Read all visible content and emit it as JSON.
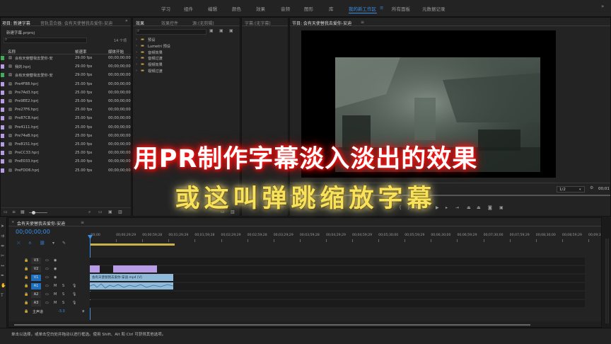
{
  "workspaces": [
    {
      "label": "学习"
    },
    {
      "label": "组件"
    },
    {
      "label": "编辑"
    },
    {
      "label": "颜色"
    },
    {
      "label": "效果"
    },
    {
      "label": "音频"
    },
    {
      "label": "图形"
    },
    {
      "label": "库"
    },
    {
      "label": "我的新工作区",
      "active": true
    },
    {
      "label": "≡"
    },
    {
      "label": "所有面板"
    },
    {
      "label": "元数据记录"
    }
  ],
  "project_panel": {
    "tabs": [
      "项目: 新建字幕",
      "音轨混合器: 会有天使替我去爱你-安迪"
    ],
    "project_file": "新建字幕.prproj",
    "item_count": "14 个项",
    "columns": {
      "name": "名称",
      "fps": "帧速率",
      "start": "媒体开始"
    },
    "items": [
      {
        "name": "会有天使替我去爱你-安",
        "fps": "29.00 fps",
        "start": "00;00;00;00",
        "color": "#3fae5a"
      },
      {
        "name": "我的.hprj",
        "fps": "29.00 fps",
        "start": "00;00;00;00",
        "color": "#b89ce6"
      },
      {
        "name": "会有天使替我去爱你-安",
        "fps": "29.00 fps",
        "start": "00;00;00;00",
        "color": "#3fae5a"
      },
      {
        "name": "Pre4F88.hprj",
        "fps": "25.00 fps",
        "start": "00;00;00;00",
        "color": "#b89ce6"
      },
      {
        "name": "Pre7Ad3.hprj",
        "fps": "25.00 fps",
        "start": "00;00;00;00",
        "color": "#b89ce6"
      },
      {
        "name": "Pre9EE2.hprj",
        "fps": "25.00 fps",
        "start": "00;00;00;00",
        "color": "#b89ce6"
      },
      {
        "name": "Pre27F6.hprj",
        "fps": "25.00 fps",
        "start": "00;00;00;00",
        "color": "#b89ce6"
      },
      {
        "name": "Pre87C8.hprj",
        "fps": "25.00 fps",
        "start": "00;00;00;00",
        "color": "#b89ce6"
      },
      {
        "name": "Pre4111.hprj",
        "fps": "25.00 fps",
        "start": "00;00;00;00",
        "color": "#b89ce6"
      },
      {
        "name": "Pre74eB.hprj",
        "fps": "25.00 fps",
        "start": "00;00;00;00",
        "color": "#b89ce6"
      },
      {
        "name": "Pre8151.hprj",
        "fps": "25.00 fps",
        "start": "00;00;00;00",
        "color": "#b89ce6"
      },
      {
        "name": "PreCC33.hprj",
        "fps": "25.00 fps",
        "start": "00;00;00;00",
        "color": "#b89ce6"
      },
      {
        "name": "PreE033.hprj",
        "fps": "25.00 fps",
        "start": "00;00;00;00",
        "color": "#b89ce6"
      },
      {
        "name": "PreFDD6.hprj",
        "fps": "25.00 fps",
        "start": "00;00;00;00",
        "color": "#b89ce6"
      }
    ]
  },
  "effects_panel": {
    "tabs": [
      "效果",
      "效果控件",
      "源:(无剪辑)"
    ],
    "tree": [
      {
        "label": "预设"
      },
      {
        "label": "Lumetri 预设"
      },
      {
        "label": "音频效果"
      },
      {
        "label": "音频过渡"
      },
      {
        "label": "视频效果"
      },
      {
        "label": "视频过渡"
      }
    ]
  },
  "source_panel": {
    "tab": "字幕:(无字幕)"
  },
  "program_panel": {
    "tab": "节目: 会有天使替我去爱你-安迪",
    "resolution": "1/2",
    "timecode": "00;01"
  },
  "timeline": {
    "tab": "会有天使替我去爱你-安迪",
    "timecode": "00;00;00;00",
    "ruler": [
      ":00;00",
      "00;00;29;29",
      "00;00;59;28",
      "00;01;29;29",
      "00;01;59;28",
      "00;02;29;29",
      "00;02;59;28",
      "00;03;29;29",
      "00;03;59;28",
      "00;04;29;29",
      "00;04;59;29",
      "00;05;30;00",
      "00;05;59;29",
      "00;06;30;00",
      "00;06;59;29",
      "00;07;30;00",
      "00;07;59;29",
      "00;08;30;00",
      "00;08;59;29",
      "00;09;30;00"
    ],
    "tracks": [
      {
        "id": "V3",
        "type": "video"
      },
      {
        "id": "V2",
        "type": "video"
      },
      {
        "id": "V1",
        "type": "video",
        "target": true
      },
      {
        "id": "A1",
        "type": "audio",
        "target": true
      },
      {
        "id": "A2",
        "type": "audio"
      },
      {
        "id": "A3",
        "type": "audio"
      }
    ],
    "master": {
      "label": "主声道",
      "value": "-3.0"
    },
    "clip_label": "会有天使替我去爱你-安迪.mp4 [V]"
  },
  "overlay": {
    "line1": "用PR制作字幕淡入淡出的效果",
    "line2": "或这叫弹跳缩放字幕"
  },
  "status": {
    "text": "单击以选择，或单击空白处并拖动以进行框选。使用 Shift、Alt 和 Ctrl 可获得其他选项。"
  },
  "colors": {
    "accent": "#3d8ee6",
    "clip_video": "#8fbad9",
    "clip_title": "#b89ce6",
    "work_area": "#c9b24a"
  }
}
